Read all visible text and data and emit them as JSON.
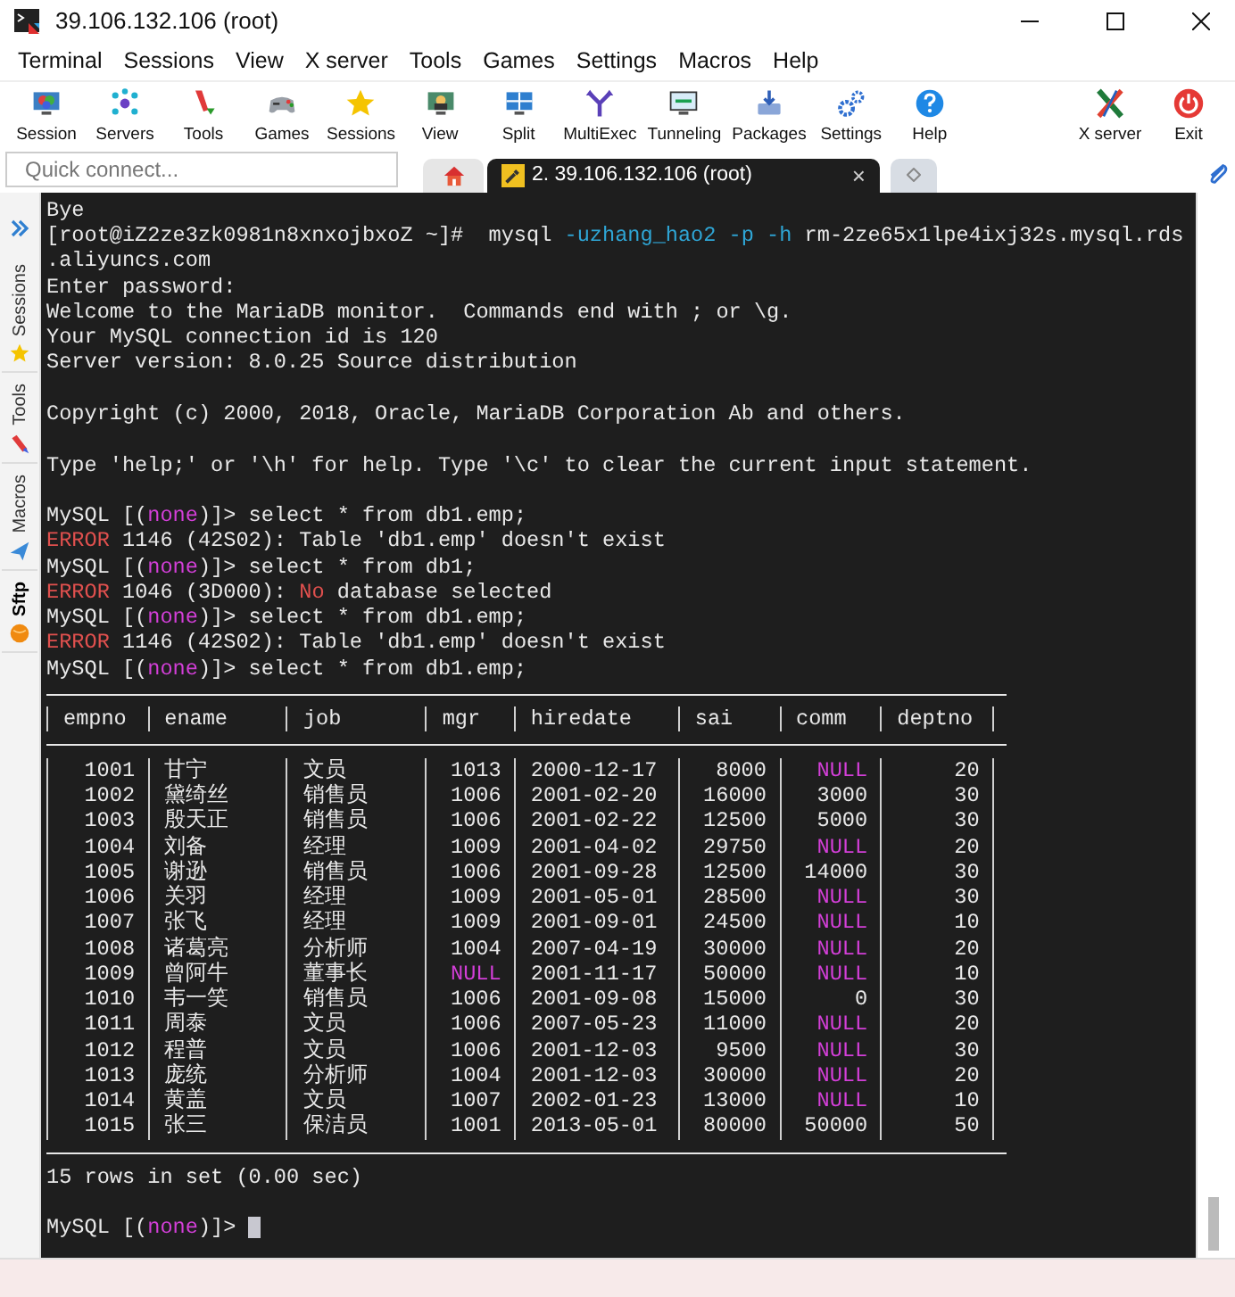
{
  "window": {
    "title": "39.106.132.106 (root)"
  },
  "menu": [
    "Terminal",
    "Sessions",
    "View",
    "X server",
    "Tools",
    "Games",
    "Settings",
    "Macros",
    "Help"
  ],
  "toolbar": {
    "left": [
      "Session",
      "Servers",
      "Tools",
      "Games",
      "Sessions",
      "View",
      "Split",
      "MultiExec",
      "Tunneling",
      "Packages",
      "Settings",
      "Help"
    ],
    "right": [
      "X server",
      "Exit"
    ]
  },
  "quick_connect": {
    "placeholder": "Quick connect..."
  },
  "tabs": [
    {
      "kind": "home",
      "selected": false
    },
    {
      "kind": "session",
      "label": "2. 39.106.132.106 (root)",
      "close": "×",
      "selected": true
    },
    {
      "kind": "new",
      "selected": false
    }
  ],
  "side_tabs": [
    {
      "label": "Sessions",
      "selected": false
    },
    {
      "label": "Tools",
      "selected": false
    },
    {
      "label": "Macros",
      "selected": false
    },
    {
      "label": "Sftp",
      "selected": true
    }
  ],
  "terminal": {
    "lines_before": [
      {
        "segments": [
          {
            "text": "Bye",
            "kind": "plain"
          }
        ]
      },
      {
        "segments": [
          {
            "text": "[root@iZ2ze3zk0981n8xnxojbxoZ ~]#  mysql ",
            "kind": "plain"
          },
          {
            "text": "-uzhang_hao2 ",
            "kind": "option"
          },
          {
            "text": "-p ",
            "kind": "option"
          },
          {
            "text": "-h",
            "kind": "option"
          },
          {
            "text": " rm-2ze65x1lpe4ixj32s.mysql.rds",
            "kind": "plain"
          }
        ]
      },
      {
        "segments": [
          {
            "text": ".aliyuncs.com",
            "kind": "plain"
          }
        ]
      },
      {
        "segments": [
          {
            "text": "Enter password:",
            "kind": "plain"
          }
        ]
      },
      {
        "segments": [
          {
            "text": "Welcome to the MariaDB monitor.  Commands end with ; or \\g.",
            "kind": "plain"
          }
        ]
      },
      {
        "segments": [
          {
            "text": "Your MySQL connection id is 120",
            "kind": "plain"
          }
        ]
      },
      {
        "segments": [
          {
            "text": "Server version: 8.0.25 Source distribution",
            "kind": "plain"
          }
        ]
      },
      {
        "kind": "blank"
      },
      {
        "segments": [
          {
            "text": "Copyright (c) 2000, 2018, Oracle, MariaDB Corporation Ab and others.",
            "kind": "plain"
          }
        ]
      },
      {
        "kind": "blank"
      },
      {
        "segments": [
          {
            "text": "Type 'help;' or '\\h' for help. Type '\\c' to clear the current input statement.",
            "kind": "plain"
          }
        ]
      },
      {
        "kind": "blank"
      },
      {
        "segments": [
          {
            "text": "MySQL [(",
            "kind": "plain"
          },
          {
            "text": "none",
            "kind": "keyword"
          },
          {
            "text": ")]> select * from db1.emp;",
            "kind": "plain"
          }
        ]
      },
      {
        "segments": [
          {
            "text": "ERROR",
            "kind": "error"
          },
          {
            "text": " 1146 (42S02): Table 'db1.emp' doesn't exist",
            "kind": "plain"
          }
        ]
      },
      {
        "segments": [
          {
            "text": "MySQL [(",
            "kind": "plain"
          },
          {
            "text": "none",
            "kind": "keyword"
          },
          {
            "text": ")]> select * from db1;",
            "kind": "plain"
          }
        ]
      },
      {
        "segments": [
          {
            "text": "ERROR",
            "kind": "error"
          },
          {
            "text": " 1046 (3D000): ",
            "kind": "plain"
          },
          {
            "text": "No",
            "kind": "error"
          },
          {
            "text": " database selected",
            "kind": "plain"
          }
        ]
      },
      {
        "segments": [
          {
            "text": "MySQL [(",
            "kind": "plain"
          },
          {
            "text": "none",
            "kind": "keyword"
          },
          {
            "text": ")]> select * from db1.emp;",
            "kind": "plain"
          }
        ]
      },
      {
        "segments": [
          {
            "text": "ERROR",
            "kind": "error"
          },
          {
            "text": " 1146 (42S02): Table 'db1.emp' doesn't exist",
            "kind": "plain"
          }
        ]
      },
      {
        "segments": [
          {
            "text": "MySQL [(",
            "kind": "plain"
          },
          {
            "text": "none",
            "kind": "keyword"
          },
          {
            "text": ")]> select * from db1.emp;",
            "kind": "plain"
          }
        ]
      }
    ],
    "table": {
      "columns": [
        {
          "label": "empno"
        },
        {
          "label": "ename"
        },
        {
          "label": "job"
        },
        {
          "label": "mgr"
        },
        {
          "label": "hiredate"
        },
        {
          "label": "sai"
        },
        {
          "label": "comm"
        },
        {
          "label": "deptno"
        }
      ],
      "rows": [
        [
          "1001",
          "甘宁",
          "文员",
          "1013",
          "2000-12-17",
          "8000",
          {
            "text": "NULL",
            "kind": "null"
          },
          "20"
        ],
        [
          "1002",
          "黛绮丝",
          "销售员",
          "1006",
          "2001-02-20",
          "16000",
          "3000",
          "30"
        ],
        [
          "1003",
          "殷天正",
          "销售员",
          "1006",
          "2001-02-22",
          "12500",
          "5000",
          "30"
        ],
        [
          "1004",
          "刘备",
          "经理",
          "1009",
          "2001-04-02",
          "29750",
          {
            "text": "NULL",
            "kind": "null"
          },
          "20"
        ],
        [
          "1005",
          "谢逊",
          "销售员",
          "1006",
          "2001-09-28",
          "12500",
          "14000",
          "30"
        ],
        [
          "1006",
          "关羽",
          "经理",
          "1009",
          "2001-05-01",
          "28500",
          {
            "text": "NULL",
            "kind": "null"
          },
          "30"
        ],
        [
          "1007",
          "张飞",
          "经理",
          "1009",
          "2001-09-01",
          "24500",
          {
            "text": "NULL",
            "kind": "null"
          },
          "10"
        ],
        [
          "1008",
          "诸葛亮",
          "分析师",
          "1004",
          "2007-04-19",
          "30000",
          {
            "text": "NULL",
            "kind": "null"
          },
          "20"
        ],
        [
          "1009",
          "曾阿牛",
          "董事长",
          {
            "text": "NULL",
            "kind": "null"
          },
          "2001-11-17",
          "50000",
          {
            "text": "NULL",
            "kind": "null"
          },
          "10"
        ],
        [
          "1010",
          "韦一笑",
          "销售员",
          "1006",
          "2001-09-08",
          "15000",
          "0",
          "30"
        ],
        [
          "1011",
          "周泰",
          "文员",
          "1006",
          "2007-05-23",
          "11000",
          {
            "text": "NULL",
            "kind": "null"
          },
          "20"
        ],
        [
          "1012",
          "程普",
          "文员",
          "1006",
          "2001-12-03",
          "9500",
          {
            "text": "NULL",
            "kind": "null"
          },
          "30"
        ],
        [
          "1013",
          "庞统",
          "分析师",
          "1004",
          "2001-12-03",
          "30000",
          {
            "text": "NULL",
            "kind": "null"
          },
          "20"
        ],
        [
          "1014",
          "黄盖",
          "文员",
          "1007",
          "2002-01-23",
          "13000",
          {
            "text": "NULL",
            "kind": "null"
          },
          "10"
        ],
        [
          "1015",
          "张三",
          "保洁员",
          "1001",
          "2013-05-01",
          "80000",
          "50000",
          "50"
        ]
      ]
    },
    "lines_after": [
      {
        "segments": [
          {
            "text": "15 rows in set (0.00 sec)",
            "kind": "plain"
          }
        ]
      },
      {
        "kind": "blank"
      },
      {
        "segments": [
          {
            "text": "MySQL [(",
            "kind": "plain"
          },
          {
            "text": "none",
            "kind": "keyword"
          },
          {
            "text": ")]> ",
            "kind": "plain"
          }
        ]
      }
    ],
    "cursor": true
  }
}
